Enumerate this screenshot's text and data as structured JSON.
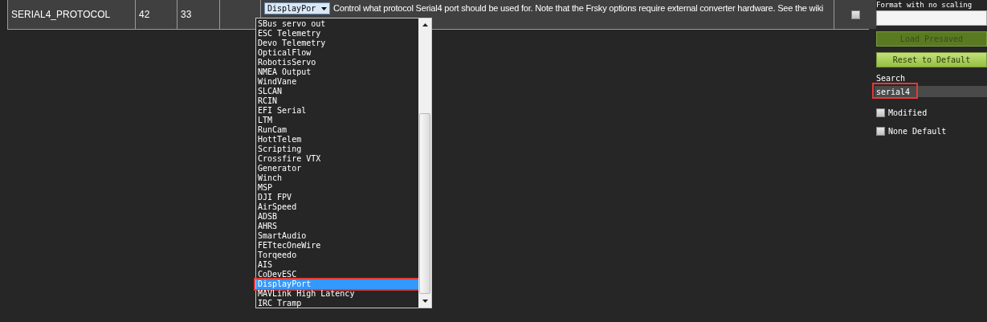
{
  "param_row": {
    "name": "SERIAL4_PROTOCOL",
    "column_2": "42",
    "column_3": "33",
    "value": "DisplayPor",
    "description": "Control what protocol Serial4 port should be used for. Note that the Frsky options require external converter hardware. See the wiki",
    "checked": false
  },
  "dropdown": {
    "options": [
      {
        "label": "SBus servo out",
        "selected": false,
        "annotated": false
      },
      {
        "label": "ESC Telemetry",
        "selected": false,
        "annotated": false
      },
      {
        "label": "Devo Telemetry",
        "selected": false,
        "annotated": false
      },
      {
        "label": "OpticalFlow",
        "selected": false,
        "annotated": false
      },
      {
        "label": "RobotisServo",
        "selected": false,
        "annotated": false
      },
      {
        "label": "NMEA Output",
        "selected": false,
        "annotated": false
      },
      {
        "label": "WindVane",
        "selected": false,
        "annotated": false
      },
      {
        "label": "SLCAN",
        "selected": false,
        "annotated": false
      },
      {
        "label": "RCIN",
        "selected": false,
        "annotated": false
      },
      {
        "label": "EFI Serial",
        "selected": false,
        "annotated": false
      },
      {
        "label": "LTM",
        "selected": false,
        "annotated": false
      },
      {
        "label": "RunCam",
        "selected": false,
        "annotated": false
      },
      {
        "label": "HottTelem",
        "selected": false,
        "annotated": false
      },
      {
        "label": "Scripting",
        "selected": false,
        "annotated": false
      },
      {
        "label": "Crossfire VTX",
        "selected": false,
        "annotated": false
      },
      {
        "label": "Generator",
        "selected": false,
        "annotated": false
      },
      {
        "label": "Winch",
        "selected": false,
        "annotated": false
      },
      {
        "label": "MSP",
        "selected": false,
        "annotated": false
      },
      {
        "label": "DJI FPV",
        "selected": false,
        "annotated": false
      },
      {
        "label": "AirSpeed",
        "selected": false,
        "annotated": false
      },
      {
        "label": "ADSB",
        "selected": false,
        "annotated": false
      },
      {
        "label": "AHRS",
        "selected": false,
        "annotated": false
      },
      {
        "label": "SmartAudio",
        "selected": false,
        "annotated": false
      },
      {
        "label": "FETtecOneWire",
        "selected": false,
        "annotated": false
      },
      {
        "label": "Torqeedo",
        "selected": false,
        "annotated": false
      },
      {
        "label": "AIS",
        "selected": false,
        "annotated": false
      },
      {
        "label": "CoDevESC",
        "selected": false,
        "annotated": false
      },
      {
        "label": "DisplayPort",
        "selected": true,
        "annotated": true
      },
      {
        "label": "MAVLink High Latency",
        "selected": false,
        "annotated": false
      },
      {
        "label": "IRC Tramp",
        "selected": false,
        "annotated": false
      }
    ]
  },
  "sidebar": {
    "format_label": "Format with no scaling",
    "buttons": [
      {
        "label": "Load Presaved",
        "disabled": true
      },
      {
        "label": "Reset to Default",
        "disabled": false
      }
    ],
    "search": {
      "label": "Search",
      "value": "serial4",
      "annotated": true
    },
    "filters": [
      {
        "label": "Modified",
        "checked": false
      },
      {
        "label": "None Default",
        "checked": false
      }
    ]
  }
}
